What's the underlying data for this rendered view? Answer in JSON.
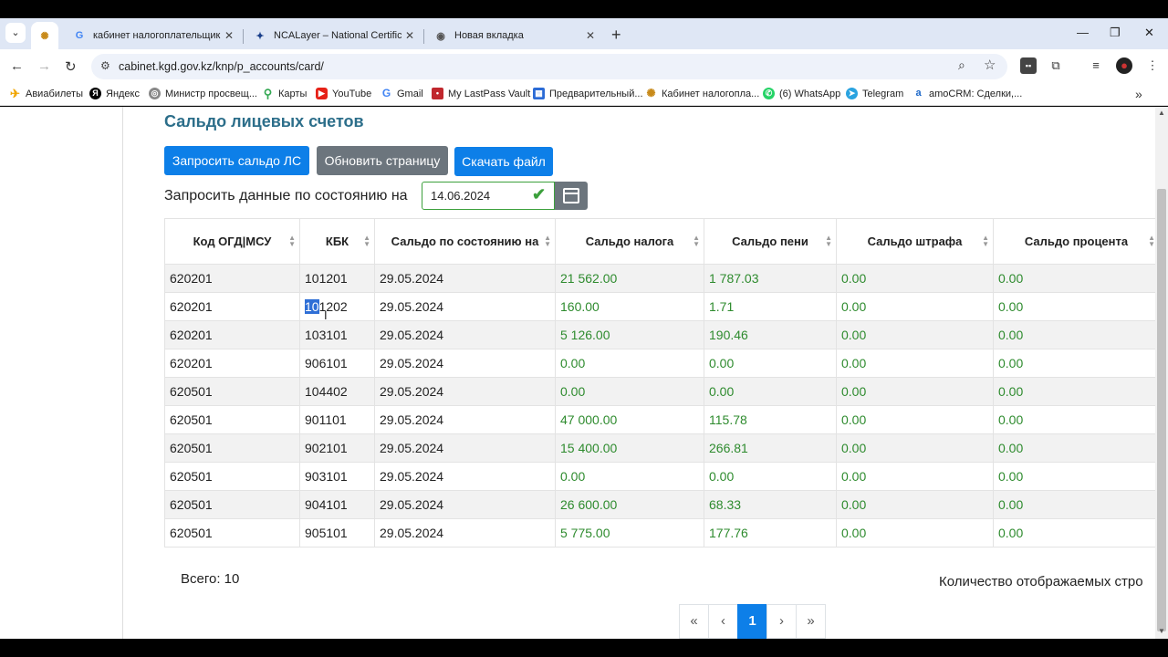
{
  "browser": {
    "tabs": [
      {
        "title": "кабинет налогоплательщика -",
        "icon": "google-icon"
      },
      {
        "title": "NCALayer – National Certificatio",
        "icon": "ncalayer-icon"
      },
      {
        "title": "Новая вкладка",
        "icon": "chrome-icon"
      }
    ],
    "url": "cabinet.kgd.gov.kz/knp/p_accounts/card/",
    "bookmarks": [
      "Авиабилеты",
      "Яндекс",
      "Министр просвещ...",
      "Карты",
      "YouTube",
      "Gmail",
      "My LastPass Vault",
      "Предварительный...",
      "Кабинет налогопла...",
      "(6) WhatsApp",
      "Telegram",
      "amoCRM: Сделки,..."
    ]
  },
  "page": {
    "title": "Сальдо лицевых счетов",
    "buttons": {
      "request": "Запросить сальдо ЛС",
      "refresh": "Обновить страницу",
      "download": "Скачать файл"
    },
    "date_label": "Запросить данные по состоянию на",
    "date_value": "14.06.2024"
  },
  "table": {
    "headers": [
      "Код ОГД|МСУ",
      "КБК",
      "Сальдо по состоянию на",
      "Сальдо налога",
      "Сальдо пени",
      "Сальдо штрафа",
      "Сальдо процента"
    ],
    "rows": [
      [
        "620201",
        "101201",
        "29.05.2024",
        "21 562.00",
        "1 787.03",
        "0.00",
        "0.00"
      ],
      [
        "620201",
        "101202",
        "29.05.2024",
        "160.00",
        "1.71",
        "0.00",
        "0.00"
      ],
      [
        "620201",
        "103101",
        "29.05.2024",
        "5 126.00",
        "190.46",
        "0.00",
        "0.00"
      ],
      [
        "620201",
        "906101",
        "29.05.2024",
        "0.00",
        "0.00",
        "0.00",
        "0.00"
      ],
      [
        "620501",
        "104402",
        "29.05.2024",
        "0.00",
        "0.00",
        "0.00",
        "0.00"
      ],
      [
        "620501",
        "901101",
        "29.05.2024",
        "47 000.00",
        "115.78",
        "0.00",
        "0.00"
      ],
      [
        "620501",
        "902101",
        "29.05.2024",
        "15 400.00",
        "266.81",
        "0.00",
        "0.00"
      ],
      [
        "620501",
        "903101",
        "29.05.2024",
        "0.00",
        "0.00",
        "0.00",
        "0.00"
      ],
      [
        "620501",
        "904101",
        "29.05.2024",
        "26 600.00",
        "68.33",
        "0.00",
        "0.00"
      ],
      [
        "620501",
        "905101",
        "29.05.2024",
        "5 775.00",
        "177.76",
        "0.00",
        "0.00"
      ]
    ]
  },
  "footer": {
    "total": "Всего: 10",
    "page_size_label": "Количество отображаемых стро",
    "pager": [
      "«",
      "‹",
      "1",
      "›",
      "»"
    ],
    "current_page": "1"
  },
  "colors": {
    "accent": "#0d7fe8",
    "secondary": "#6c757d",
    "money": "#2e8b2e",
    "title": "#2c6e8a"
  }
}
